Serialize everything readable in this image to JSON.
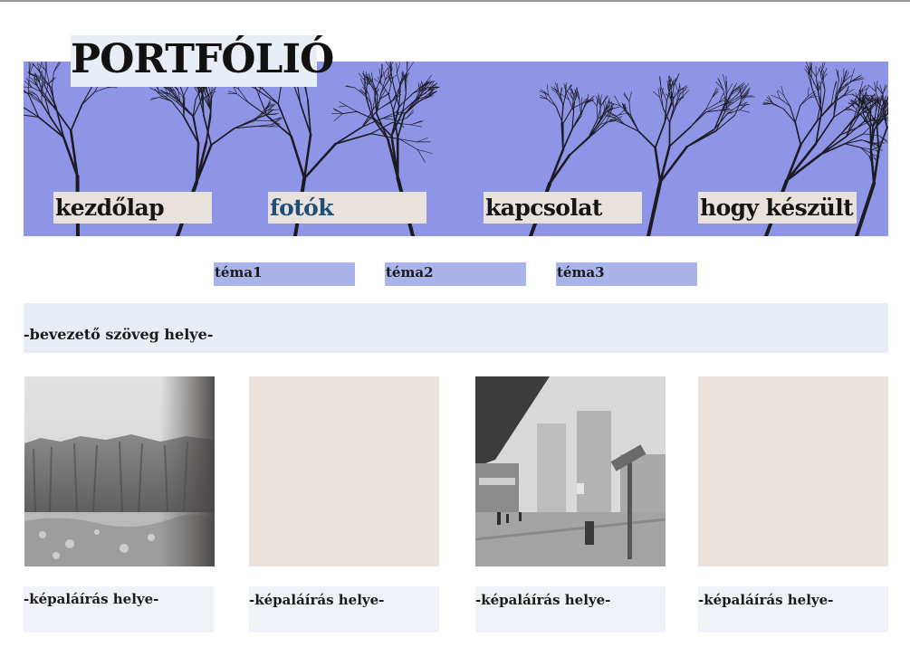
{
  "header": {
    "title": "PORTFÓLIÓ",
    "banner_image": "bare tree branches against blue sky"
  },
  "nav": {
    "items": [
      {
        "label": "kezdőlap"
      },
      {
        "label": "fotók",
        "active": true
      },
      {
        "label": "kapcsolat"
      },
      {
        "label": "hogy készült"
      }
    ]
  },
  "topics": {
    "items": [
      {
        "label": "téma1"
      },
      {
        "label": "téma2"
      },
      {
        "label": "téma3"
      }
    ]
  },
  "intro": {
    "text": "-bevezető szöveg helye-"
  },
  "gallery": {
    "items": [
      {
        "image": "black and white cliff landscape",
        "caption": "-képaláírás helye-"
      },
      {
        "image": "empty placeholder",
        "caption": "-képaláírás helye-"
      },
      {
        "image": "foggy city street with tower blocks",
        "caption": "-képaláírás helye-"
      },
      {
        "image": "empty placeholder",
        "caption": "-képaláírás helye-"
      }
    ]
  },
  "colors": {
    "banner_sky": "#8e95e6",
    "nav_bg": "#e8e1dc",
    "nav_active_text": "#1f4e79",
    "topic_bg": "#a8b4ea",
    "intro_bg": "#e8ecf4",
    "caption_bg": "#eff3f7"
  }
}
